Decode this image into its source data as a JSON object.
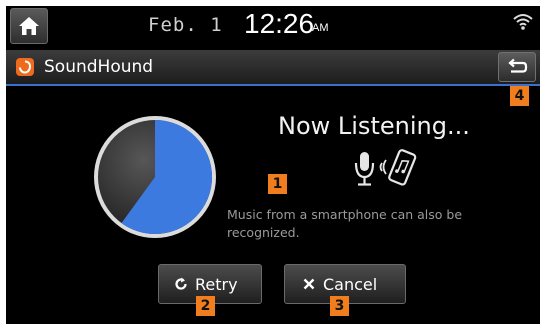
{
  "status_bar": {
    "date": "Feb.  1",
    "time": "12:26",
    "ampm": "AM",
    "icons": {
      "home": "home-icon",
      "wifi": "wifi-icon"
    }
  },
  "title_bar": {
    "app_name": "SoundHound",
    "icons": {
      "app": "soundhound-logo-icon",
      "back": "back-arrow-icon"
    }
  },
  "listening": {
    "title": "Now Listening...",
    "info": "Music from a smartphone can also be recognized.",
    "progress_fraction": 0.6,
    "icons": {
      "mic": "microphone-icon",
      "phone": "smartphone-icon"
    }
  },
  "buttons": {
    "retry": {
      "label": "Retry",
      "icon": "retry-icon"
    },
    "cancel": {
      "label": "Cancel",
      "icon": "close-icon"
    }
  },
  "callouts": [
    "1",
    "2",
    "3",
    "4"
  ],
  "colors": {
    "accent": "#3d7ae0",
    "badge": "#f07e1e",
    "app_icon": "#ee6a1c",
    "background": "#000000"
  }
}
